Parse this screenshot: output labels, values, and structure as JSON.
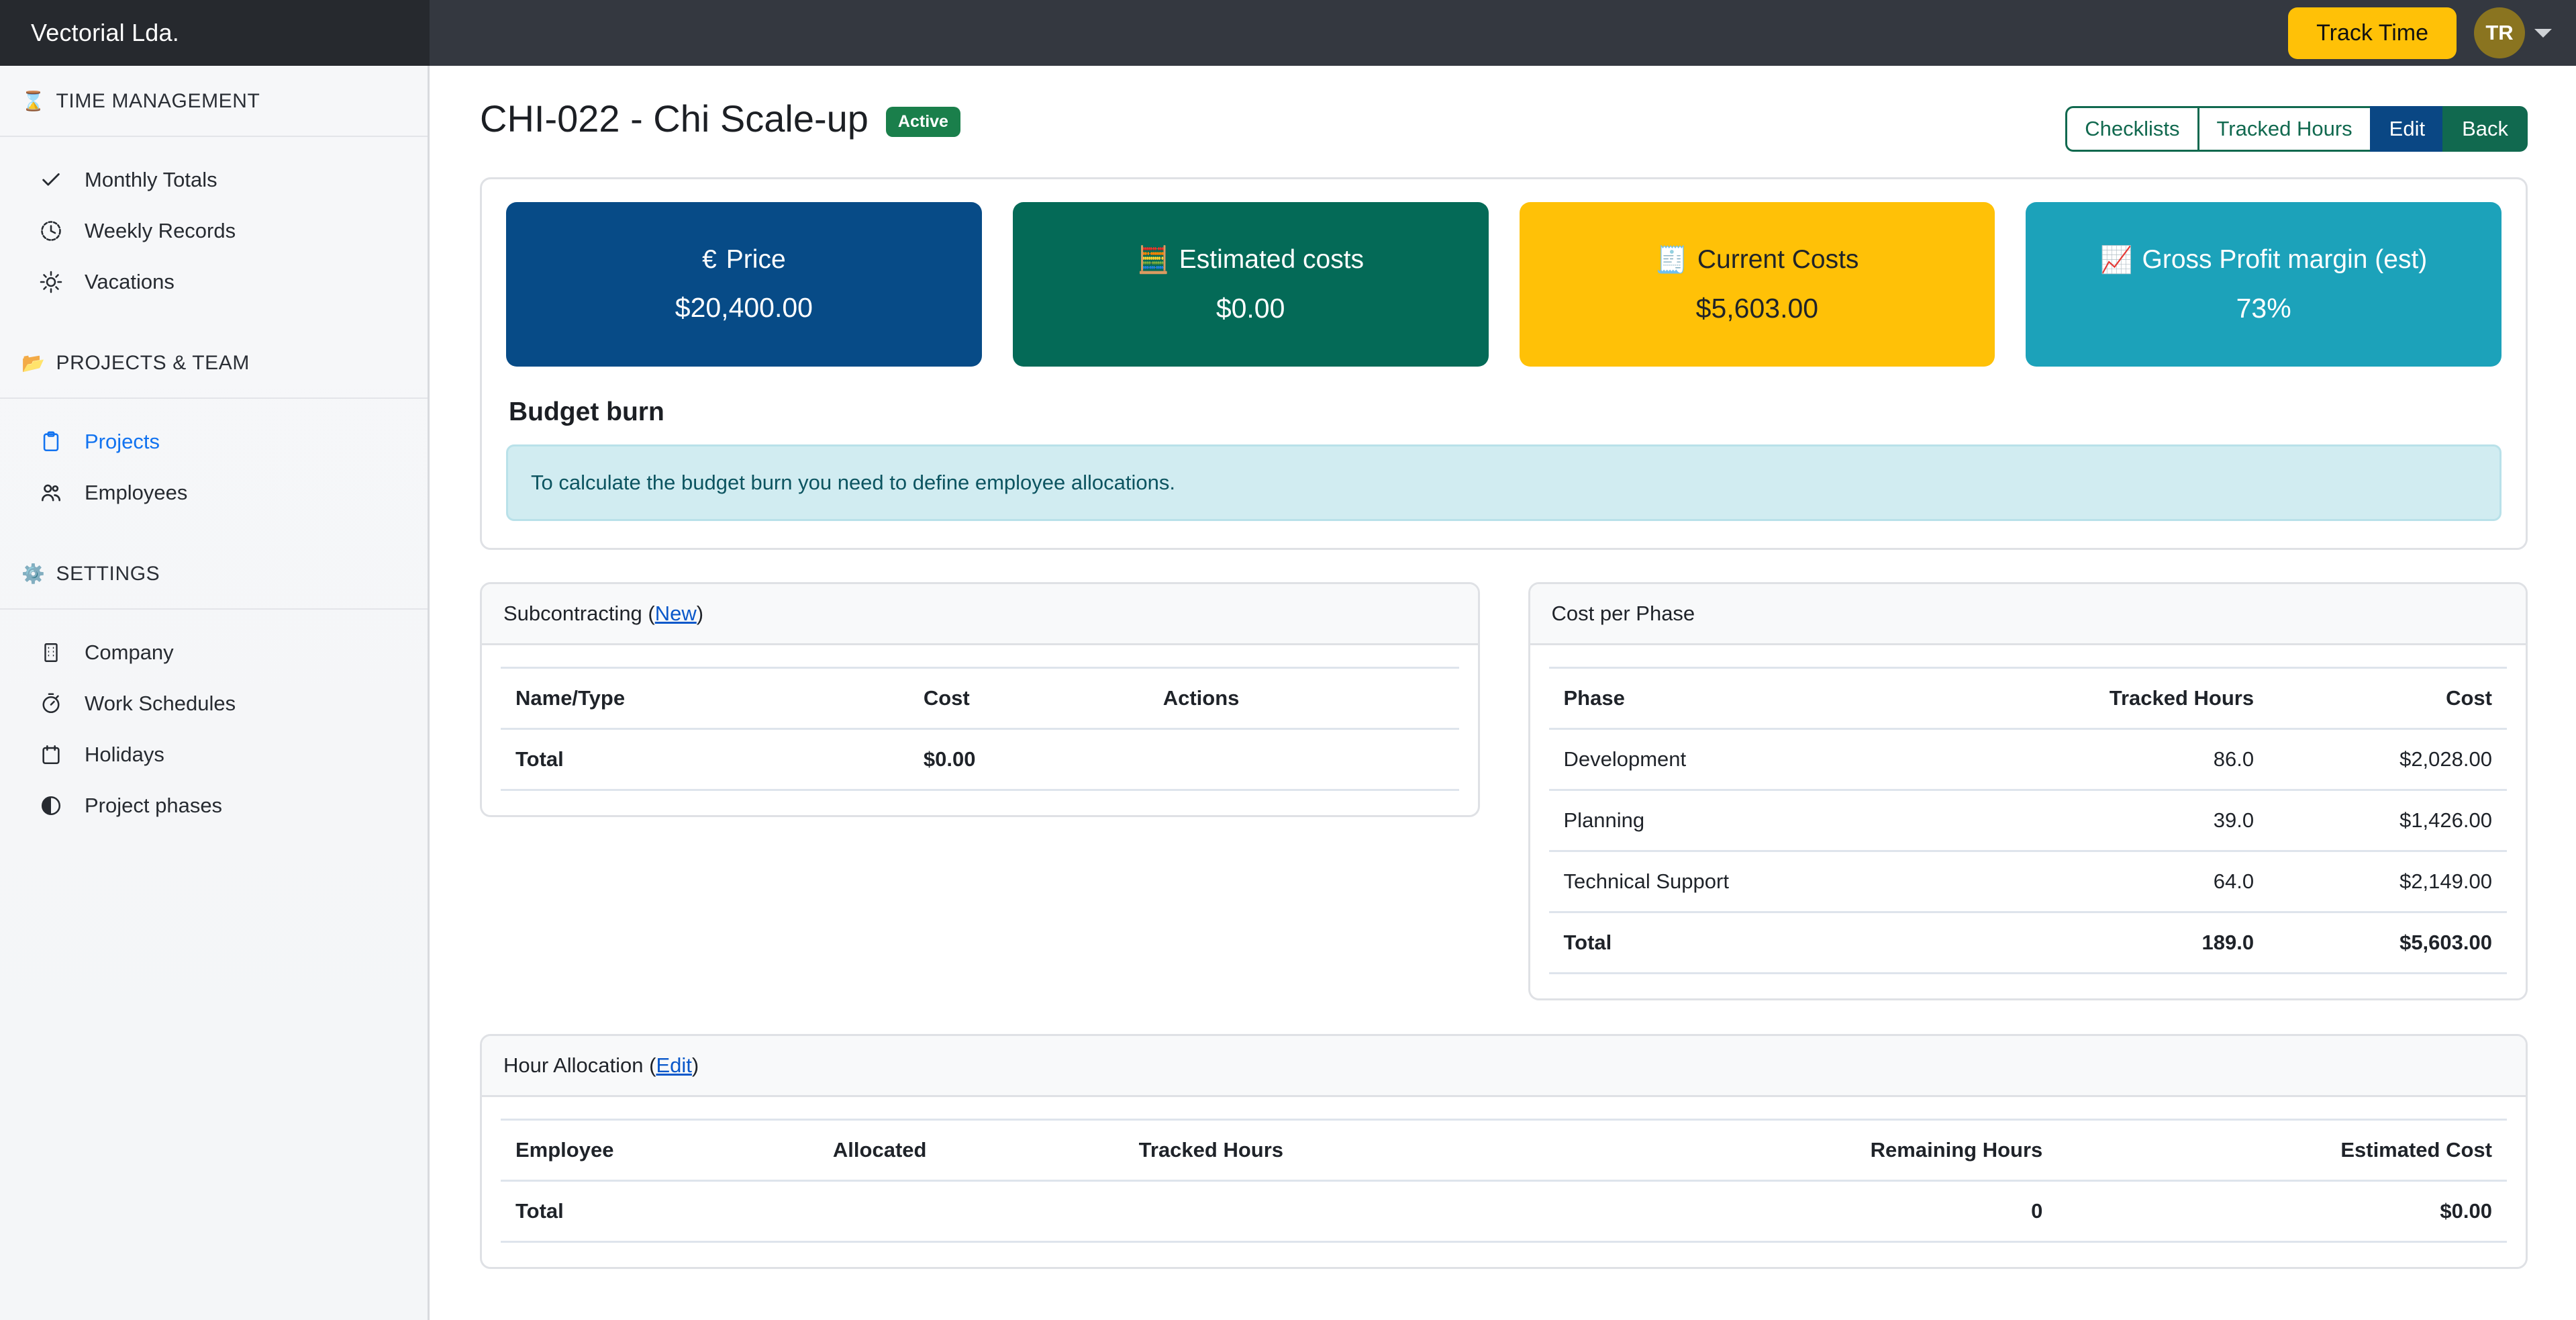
{
  "brand": {
    "name": "Vectorial Lda."
  },
  "topbar": {
    "track_time_label": "Track Time",
    "avatar_initials": "TR",
    "avatar_color": "#8a7420",
    "track_time_color": "#ffc107"
  },
  "sidebar": {
    "sections": [
      {
        "label": "TIME MANAGEMENT",
        "icon": "hourglass-icon",
        "items": [
          {
            "label": "Monthly Totals",
            "icon": "check-icon",
            "active": false
          },
          {
            "label": "Weekly Records",
            "icon": "clock-icon",
            "active": false
          },
          {
            "label": "Vacations",
            "icon": "sun-icon",
            "active": false
          }
        ]
      },
      {
        "label": "PROJECTS & TEAM",
        "icon": "folder-icon",
        "items": [
          {
            "label": "Projects",
            "icon": "clipboard-icon",
            "active": true
          },
          {
            "label": "Employees",
            "icon": "people-icon",
            "active": false
          }
        ]
      },
      {
        "label": "SETTINGS",
        "icon": "gear-icon",
        "items": [
          {
            "label": "Company",
            "icon": "building-icon",
            "active": false
          },
          {
            "label": "Work Schedules",
            "icon": "stopwatch-icon",
            "active": false
          },
          {
            "label": "Holidays",
            "icon": "calendar-icon",
            "active": false
          },
          {
            "label": "Project phases",
            "icon": "half-circle-icon",
            "active": false
          }
        ]
      }
    ]
  },
  "page": {
    "title": "CHI-022 - Chi Scale-up",
    "status_badge": "Active",
    "status_color": "#1a7f4b",
    "actions": [
      {
        "label": "Checklists",
        "style": "outline"
      },
      {
        "label": "Tracked Hours",
        "style": "outline"
      },
      {
        "label": "Edit",
        "style": "navy"
      },
      {
        "label": "Back",
        "style": "green"
      }
    ]
  },
  "kpis": [
    {
      "title": "Price",
      "icon": "euro-icon",
      "value": "$20,400.00",
      "color": "#074b87",
      "text": "light"
    },
    {
      "title": "Estimated costs",
      "icon": "calculator-icon",
      "value": "$0.00",
      "color": "#046a57",
      "text": "light"
    },
    {
      "title": "Current Costs",
      "icon": "receipt-icon",
      "value": "$5,603.00",
      "color": "#ffc107",
      "text": "dark"
    },
    {
      "title": "Gross Profit margin (est)",
      "icon": "chart-increasing-icon",
      "value": "73%",
      "color": "#1ca2ba",
      "text": "light"
    }
  ],
  "budget_burn": {
    "title": "Budget burn",
    "message": "To calculate the budget burn you need to define employee allocations."
  },
  "subcontracting": {
    "title": "Subcontracting (",
    "link": "New",
    "title_close": ")",
    "columns": [
      "Name/Type",
      "Cost",
      "Actions"
    ],
    "total_row": {
      "label": "Total",
      "cost": "$0.00",
      "actions": ""
    }
  },
  "cost_per_phase": {
    "title": "Cost per Phase",
    "columns": [
      "Phase",
      "Tracked Hours",
      "Cost"
    ],
    "rows": [
      {
        "phase": "Development",
        "tracked_hours": "86.0",
        "cost": "$2,028.00"
      },
      {
        "phase": "Planning",
        "tracked_hours": "39.0",
        "cost": "$1,426.00"
      },
      {
        "phase": "Technical Support",
        "tracked_hours": "64.0",
        "cost": "$2,149.00"
      }
    ],
    "total_row": {
      "phase": "Total",
      "tracked_hours": "189.0",
      "cost": "$5,603.00"
    }
  },
  "hour_allocation": {
    "title": "Hour Allocation (",
    "link": "Edit",
    "title_close": ")",
    "columns": [
      "Employee",
      "Allocated",
      "Tracked Hours",
      "Remaining Hours",
      "Estimated Cost"
    ],
    "total_row": {
      "employee": "Total",
      "allocated": "",
      "tracked_hours": "",
      "remaining_hours": "0",
      "estimated_cost": "$0.00"
    }
  }
}
